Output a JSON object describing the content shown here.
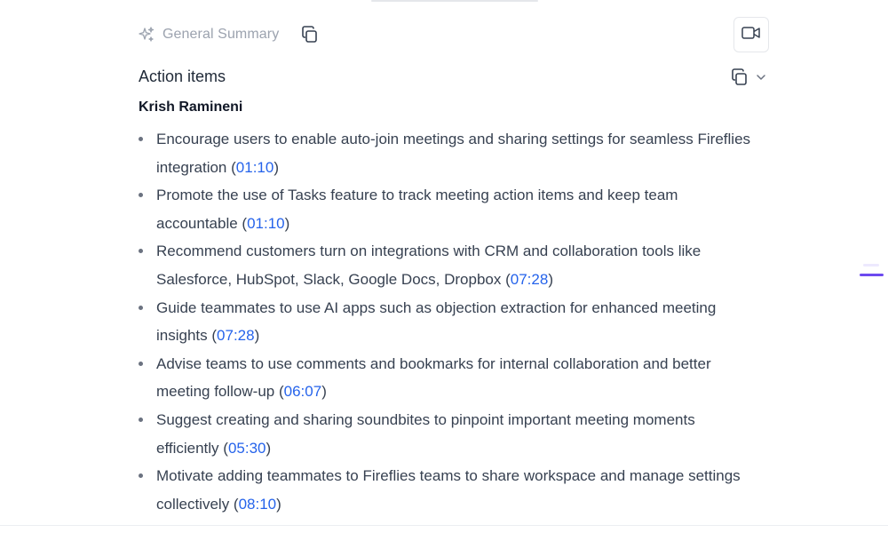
{
  "summary": {
    "title": "General Summary",
    "sparkle_icon": "sparkle-icon",
    "copy_icon": "copy-icon",
    "video_icon": "video-camera-icon"
  },
  "action_items": {
    "heading": "Action items",
    "copy_icon": "copy-icon",
    "collapse_icon": "chevron-down-icon",
    "assignee": "Krish Ramineni",
    "items": [
      {
        "text": "Encourage users to enable auto-join meetings and sharing settings for seamless Fireflies integration",
        "timestamp": "01:10"
      },
      {
        "text": "Promote the use of Tasks feature to track meeting action items and keep team accountable",
        "timestamp": "01:10"
      },
      {
        "text": "Recommend customers turn on integrations with CRM and collaboration tools like Salesforce, HubSpot, Slack, Google Docs, Dropbox",
        "timestamp": "07:28"
      },
      {
        "text": "Guide teammates to use AI apps such as objection extraction for enhanced meeting insights",
        "timestamp": "07:28"
      },
      {
        "text": "Advise teams to use comments and bookmarks for internal collaboration and better meeting follow-up",
        "timestamp": "06:07"
      },
      {
        "text": "Suggest creating and sharing soundbites to pinpoint important meeting moments efficiently",
        "timestamp": "05:30"
      },
      {
        "text": "Motivate adding teammates to Fireflies teams to share workspace and manage settings collectively",
        "timestamp": "08:10"
      }
    ]
  },
  "colors": {
    "accent": "#6d4aef",
    "timestamp_link": "#2563eb",
    "muted_text": "#9ca3af",
    "body_text": "#374151"
  }
}
